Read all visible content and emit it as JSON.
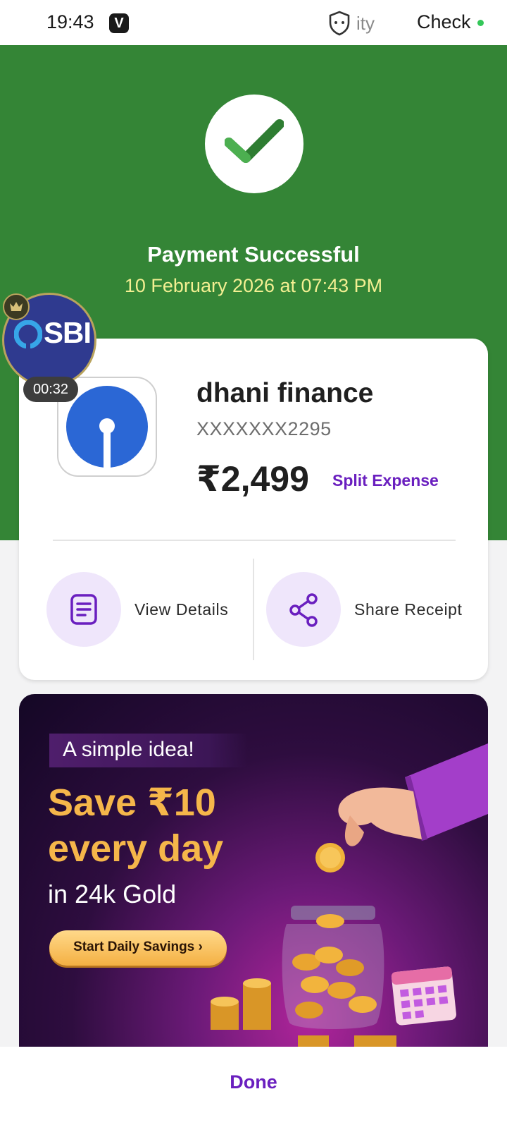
{
  "status_bar": {
    "time": "19:43",
    "app_icon_letter": "V",
    "truncated_label": "ity",
    "check_label": "Check"
  },
  "header": {
    "title": "Payment Successful",
    "date": "10 February 2026 at 07:43 PM",
    "background_color": "#348536"
  },
  "receipt": {
    "bank_icon": "sbi-logo-icon",
    "payee": "dhani finance",
    "account": "XXXXXXX2295",
    "amount": "₹2,499",
    "split_label": "Split Expense",
    "actions": [
      {
        "label": "View Details",
        "icon": "document-icon"
      },
      {
        "label": "Share Receipt",
        "icon": "share-icon"
      }
    ]
  },
  "promo": {
    "tag": "A simple idea!",
    "line1": "Save ₹10",
    "line2": "every day",
    "line3": "in 24k Gold",
    "cta": "Start Daily Savings ›"
  },
  "overlay": {
    "bubble_text": "SBI",
    "timer": "00:32"
  },
  "footer": {
    "done_label": "Done",
    "accent_color": "#6a1fbf"
  }
}
